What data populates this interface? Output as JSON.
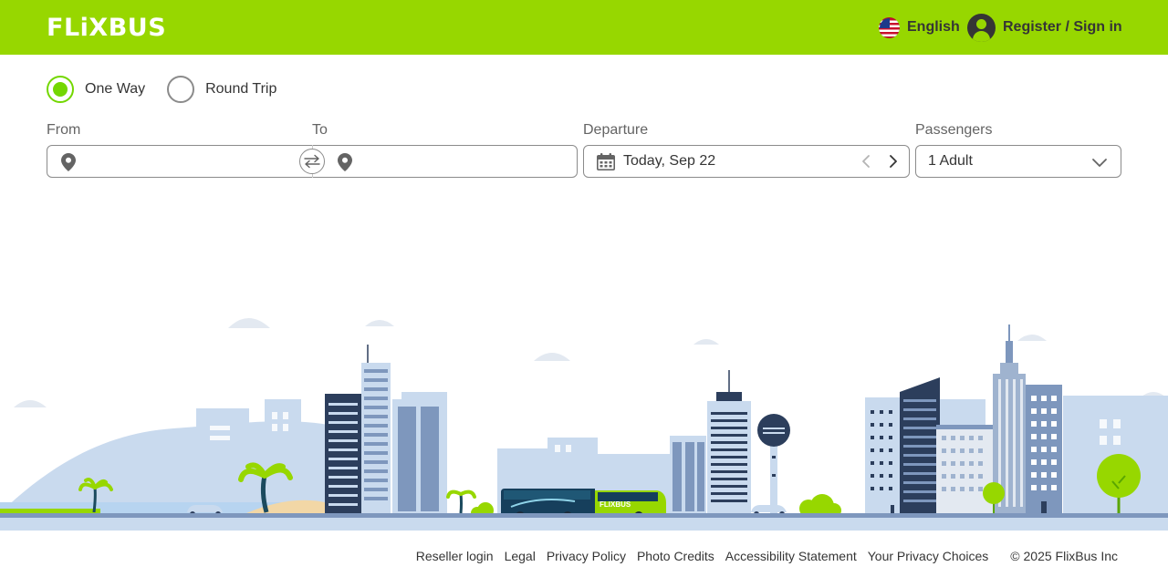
{
  "header": {
    "brand": "FLiXBUS",
    "language": "English",
    "account": "Register / Sign in"
  },
  "search": {
    "trip_types": [
      {
        "label": "One Way",
        "selected": true
      },
      {
        "label": "Round Trip",
        "selected": false
      }
    ],
    "from_label": "From",
    "to_label": "To",
    "from_value": "",
    "to_value": "",
    "departure_label": "Departure",
    "departure_value": "Today, Sep 22",
    "passengers_label": "Passengers",
    "passengers_value": "1 Adult"
  },
  "illustration": {
    "bus_text": "FLIXBUS"
  },
  "footer": {
    "links": [
      "Reseller login",
      "Legal",
      "Privacy Policy",
      "Photo Credits",
      "Accessibility Statement",
      "Your Privacy Choices"
    ],
    "copyright": "© 2025 FlixBus Inc"
  },
  "colors": {
    "brand_green": "#97d700",
    "accent_green": "#73d700",
    "text_dark": "#353535",
    "skyline_light": "#c9daee",
    "skyline_mid": "#7e97bd",
    "bus_dark": "#163f5c"
  },
  "icons": [
    "us-flag-icon",
    "user-avatar-icon",
    "location-pin-icon",
    "swap-icon",
    "calendar-icon",
    "chevron-left-icon",
    "chevron-right-icon",
    "chevron-down-icon"
  ]
}
